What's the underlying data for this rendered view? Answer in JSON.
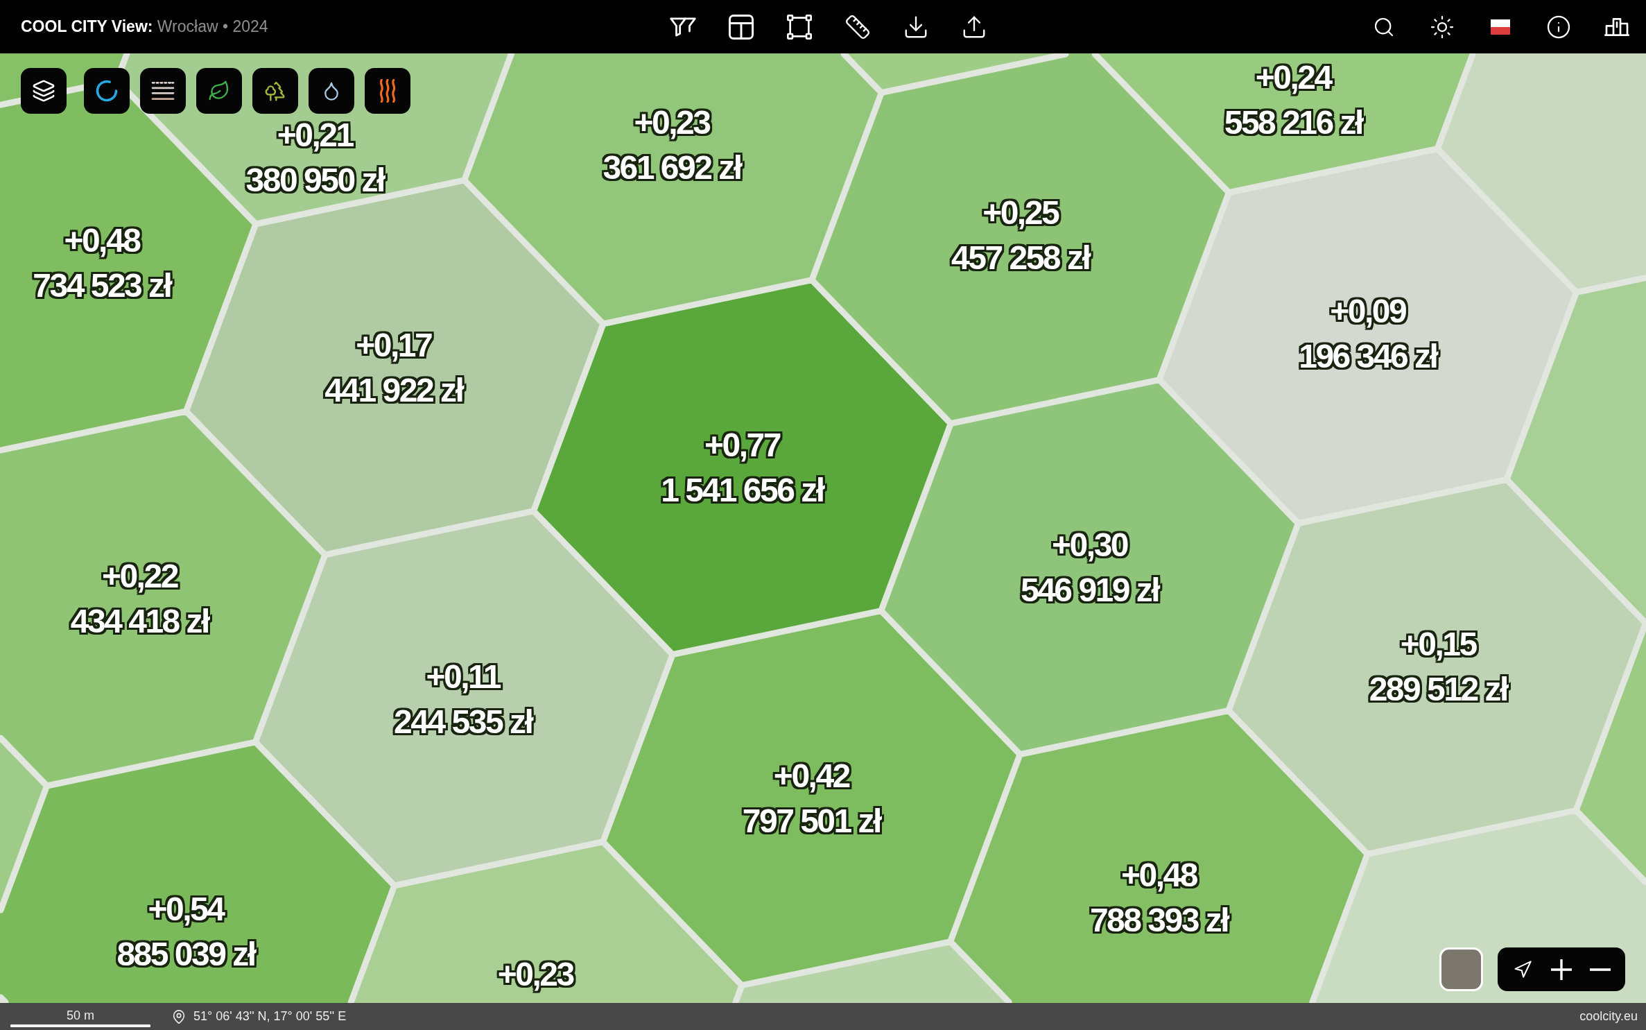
{
  "header": {
    "title": "**COOL CITY View:** Wrocław • 2024"
  },
  "map": {
    "hexagons": [
      {
        "color": "#9fcd88"
      },
      {
        "color": "#98ca7f",
        "score": "+0,24",
        "value": "558 216 zł"
      },
      {
        "color": "#86c067"
      },
      {
        "color": "#a3cc90",
        "score": "+0,21",
        "value": "380 950 zł"
      },
      {
        "color": "#c8d9c0"
      },
      {
        "color": "#92c67a",
        "score": "+0,23",
        "value": "361 692 zł"
      },
      {
        "color": "#8dc374",
        "score": "+0,25",
        "value": "457 258 zł"
      },
      {
        "color": "#7fbd60",
        "score": "+0,48",
        "value": "734 523 zł"
      },
      {
        "color": "#d3d9d1",
        "score": "+0,09",
        "value": "196 346 zł"
      },
      {
        "color": "#b0cba3",
        "score": "+0,17",
        "value": "441 922 zł"
      },
      {
        "color": "#a8cf95"
      },
      {
        "color": "#5aa83c",
        "score": "+0,77",
        "value": "1 541 656 zł"
      },
      {
        "color": "#8ec57a",
        "score": "+0,30",
        "value": "546 919 zł"
      },
      {
        "color": "#8fc475",
        "score": "+0,22",
        "value": "434 418 zł"
      },
      {
        "color": "#bdd3b3",
        "score": "+0,15",
        "value": "289 512 zł"
      },
      {
        "color": "#b8cfae",
        "score": "+0,11",
        "value": "244 535 zł"
      },
      {
        "color": "#9ccb84"
      },
      {
        "color": "#7dbd5f",
        "score": "+0,42",
        "value": "797 501 zł"
      },
      {
        "color": "#9ecb87"
      },
      {
        "color": "#84bf66",
        "score": "+0,48",
        "value": "788 393 zł"
      },
      {
        "color": "#7aba5a",
        "score": "+0,54",
        "value": "885 039 zł"
      },
      {
        "color": "#c9dbc0"
      },
      {
        "color": "#a9cf95",
        "score": "+0,23"
      },
      {
        "color": "#b6d4a7"
      }
    ]
  },
  "status_bar": {
    "scale": "50 m",
    "coordinates": "51° 06' 43'' N, 17° 00' 55'' E",
    "site": "coolcity.eu"
  }
}
